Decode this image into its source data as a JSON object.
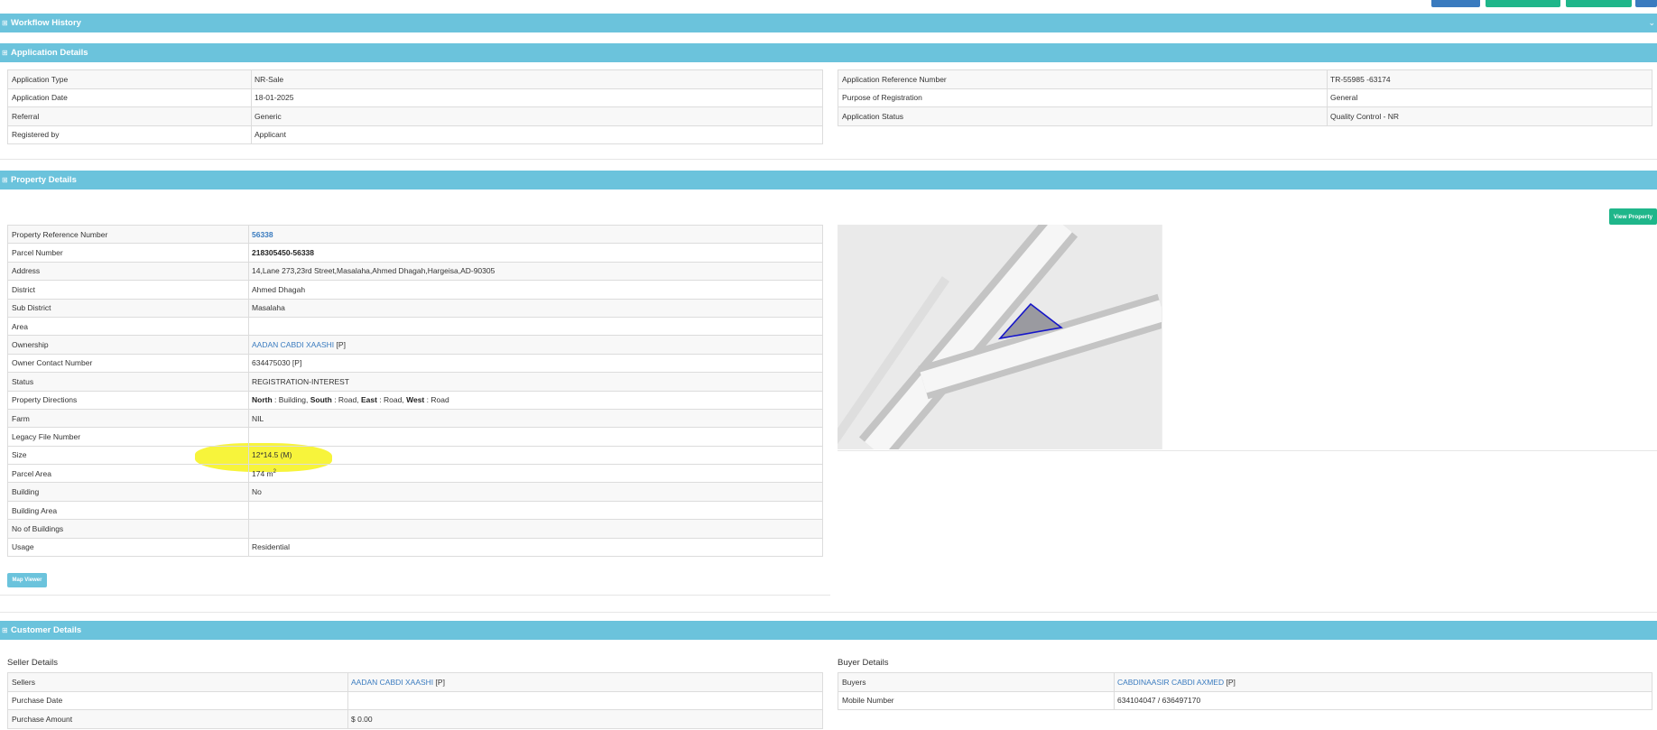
{
  "colors": {
    "section_bar": "#6bc3dc",
    "link": "#3a7bbf",
    "view_property_button": "#1fb68a",
    "map_viewer_button": "#6bc3dc",
    "highlight": "#f7f43b",
    "parcel_outline": "#1515c8",
    "parcel_fill": "#9a9aa0"
  },
  "top_actions": {
    "buttons": [
      {
        "name": "blue-action",
        "color": "#3a7bbf"
      },
      {
        "name": "green-action-1",
        "color": "#1fb68a"
      },
      {
        "name": "green-action-2",
        "color": "#1fb68a"
      },
      {
        "name": "blue-action-edge",
        "color": "#3a7bbf"
      }
    ]
  },
  "sections": {
    "workflow_history": {
      "title": "Workflow History",
      "icon": "expand-icon",
      "toggle_icon": "chevron-down-icon"
    },
    "application_details": {
      "title": "Application Details",
      "icon": "expand-icon"
    },
    "property_details": {
      "title": "Property Details",
      "icon": "expand-icon"
    },
    "customer_details": {
      "title": "Customer Details",
      "icon": "expand-icon"
    }
  },
  "application": {
    "left": [
      {
        "label": "Application Type",
        "value": "NR-Sale"
      },
      {
        "label": "Application Date",
        "value": "18-01-2025"
      },
      {
        "label": "Referral",
        "value": "Generic"
      },
      {
        "label": "Registered by",
        "value": "Applicant"
      }
    ],
    "right": [
      {
        "label": "Application Reference Number",
        "value": "TR-55985 -63174"
      },
      {
        "label": "Purpose of Registration",
        "value": "General"
      },
      {
        "label": "Application Status",
        "value": "Quality Control - NR"
      }
    ]
  },
  "property": {
    "view_property_label": "View Property",
    "map_viewer_label": "Map Viewer",
    "reference_number": {
      "label": "Property Reference Number",
      "value": "56338"
    },
    "parcel_number": {
      "label": "Parcel Number",
      "value": "218305450-56338"
    },
    "address": {
      "label": "Address",
      "value": "14,Lane 273,23rd Street,Masalaha,Ahmed Dhagah,Hargeisa,AD-90305"
    },
    "district": {
      "label": "District",
      "value": "Ahmed Dhagah"
    },
    "sub_district": {
      "label": "Sub District",
      "value": "Masalaha"
    },
    "area": {
      "label": "Area",
      "value": ""
    },
    "ownership": {
      "label": "Ownership",
      "owner": "AADAN CABDI XAASHI",
      "tag": "[P]"
    },
    "owner_contact": {
      "label": "Owner Contact Number",
      "value": "634475030 [P]"
    },
    "status": {
      "label": "Status",
      "value": "REGISTRATION-INTEREST"
    },
    "directions": {
      "label": "Property Directions",
      "north_label": "North",
      "north": "Building",
      "south_label": "South",
      "south": "Road",
      "east_label": "East",
      "east": "Road",
      "west_label": "West",
      "west": "Road",
      "sep": " : ",
      "comma": ", "
    },
    "farm": {
      "label": "Farm",
      "value": "NIL"
    },
    "legacy_file_number": {
      "label": "Legacy File Number",
      "value": ""
    },
    "size": {
      "label": "Size",
      "value": "12*14.5 (M)"
    },
    "parcel_area": {
      "label": "Parcel Area",
      "value": "174 m",
      "unit_sup": "2"
    },
    "building": {
      "label": "Building",
      "value": "No"
    },
    "building_area": {
      "label": "Building Area",
      "value": ""
    },
    "no_of_buildings": {
      "label": "No of Buildings",
      "value": ""
    },
    "usage": {
      "label": "Usage",
      "value": "Residential"
    }
  },
  "customer": {
    "seller_heading": "Seller Details",
    "buyer_heading": "Buyer Details",
    "sellers": {
      "label": "Sellers",
      "name": "AADAN CABDI XAASHI",
      "tag": "[P]"
    },
    "purchase_date": {
      "label": "Purchase Date",
      "value": ""
    },
    "purchase_amount": {
      "label": "Purchase Amount",
      "value": "$ 0.00"
    },
    "buyers": {
      "label": "Buyers",
      "name": "CABDINAASIR CABDI AXMED",
      "tag": "[P]"
    },
    "mobile_number": {
      "label": "Mobile Number",
      "value": "634104047 / 636497170"
    }
  }
}
